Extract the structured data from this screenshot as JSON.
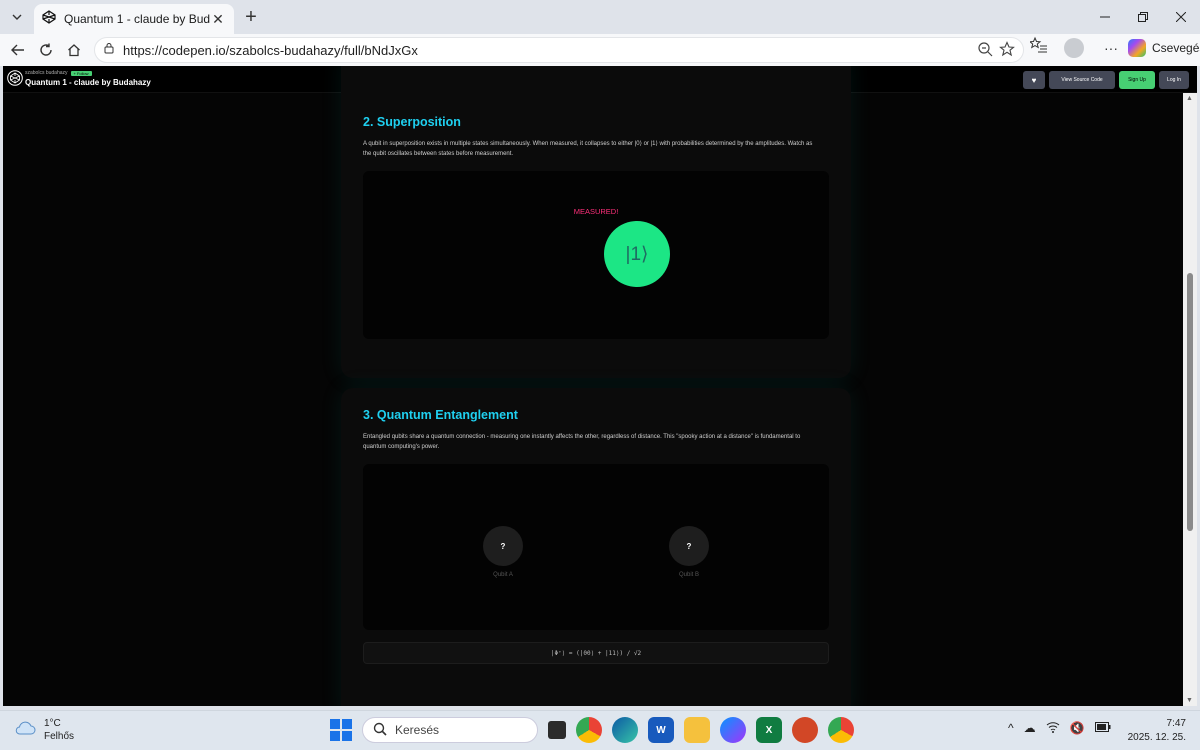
{
  "browser": {
    "tab_title": "Quantum 1 - claude by Budahazy",
    "tab_close": "✕",
    "new_tab": "+",
    "url": "https://codepen.io/szabolcs-budahazy/full/bNdJxGx",
    "copilot_label": "Csevegés",
    "more": "···"
  },
  "codepen": {
    "username": "szabolcs budahazy",
    "follow_label": "+ Follow",
    "pen_title": "Quantum 1 - claude by Budahazy",
    "heart": "♥",
    "view_source": "View Source Code",
    "sign_up": "Sign Up",
    "log_in": "Log In"
  },
  "superposition": {
    "title": "2. Superposition",
    "description": "A qubit in superposition exists in multiple states simultaneously. When measured, it collapses to either |0⟩ or |1⟩ with probabilities determined by the amplitudes. Watch as the qubit oscillates between states before measurement.",
    "status": "MEASURED!",
    "qubit_state": "|1⟩"
  },
  "entanglement": {
    "title": "3. Quantum Entanglement",
    "description": "Entangled qubits share a quantum connection - measuring one instantly affects the other, regardless of distance. This \"spooky action at a distance\" is fundamental to quantum computing's power.",
    "qubit_a_value": "?",
    "qubit_a_label": "Qubit A",
    "qubit_b_value": "?",
    "qubit_b_label": "Qubit B",
    "formula": "|Φ⁺⟩ = (|00⟩ + |11⟩) / √2"
  },
  "taskbar": {
    "temperature": "1°C",
    "weather": "Felhős",
    "search_placeholder": "Keresés",
    "time": "7:47",
    "date": "2025. 12. 25."
  },
  "colors": {
    "accent_cyan": "#1fd0f0",
    "qubit_green": "#1ce685",
    "measured_pink": "#ff2f7a",
    "codepen_green": "#47cf73"
  }
}
